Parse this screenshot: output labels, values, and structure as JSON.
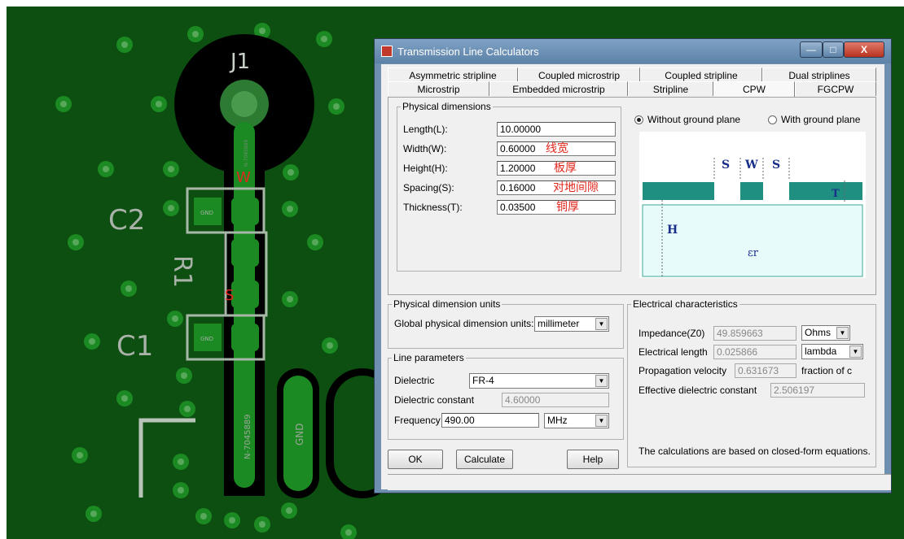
{
  "pcb": {
    "ref_j1": "J1",
    "ref_c2": "C2",
    "ref_c1": "C1",
    "ref_r1": "R1",
    "mark_w": "W",
    "mark_s": "S",
    "pad_gnd_1": "GND",
    "pad_gnd_2": "GND",
    "gnd_label": "GND",
    "net_label_bottom": "N-7045889",
    "net_label_top": "N-7045889",
    "colors": {
      "board": "#0c4f11",
      "copper": "#1c8a23",
      "text": "#9aa89a",
      "annotation": "#e0271c"
    }
  },
  "window": {
    "title": "Transmission Line Calculators",
    "controls": {
      "minimize": "—",
      "maximize": "□",
      "close": "X"
    }
  },
  "tabs": {
    "row1": [
      "Asymmetric stripline",
      "Coupled microstrip",
      "Coupled stripline",
      "Dual striplines"
    ],
    "row2": [
      "Microstrip",
      "Embedded microstrip",
      "Stripline",
      "CPW",
      "FGCPW"
    ],
    "active": "CPW"
  },
  "physical": {
    "legend": "Physical dimensions",
    "length": {
      "label": "Length(L):",
      "value": "10.00000"
    },
    "width": {
      "label": "Width(W):",
      "value": "0.60000",
      "note": "线宽"
    },
    "height": {
      "label": "Height(H):",
      "value": "1.20000",
      "note": "板厚"
    },
    "spacing": {
      "label": "Spacing(S):",
      "value": "0.16000",
      "note": "对地间隙"
    },
    "thickness": {
      "label": "Thickness(T):",
      "value": "0.03500",
      "note": "铜厚"
    }
  },
  "ground": {
    "without": "Without ground plane",
    "with": "With ground plane",
    "selected": "without"
  },
  "diagram": {
    "S1": "S",
    "W": "W",
    "S2": "S",
    "T": "T",
    "H": "H",
    "eps": "εr"
  },
  "units": {
    "legend": "Physical dimension units",
    "label": "Global physical dimension units:",
    "value": "millimeter"
  },
  "line": {
    "legend": "Line parameters",
    "dielectric_label": "Dielectric",
    "dielectric_value": "FR-4",
    "dk_label": "Dielectric constant",
    "dk_value": "4.60000",
    "freq_label": "Frequency",
    "freq_value": "490.00",
    "freq_unit": "MHz"
  },
  "electrical": {
    "legend": "Electrical characteristics",
    "z0_label": "Impedance(Z0)",
    "z0_value": "49.859663",
    "z0_unit": "Ohms",
    "len_label": "Electrical length",
    "len_value": "0.025866",
    "len_unit": "lambda",
    "vp_label": "Propagation velocity",
    "vp_value": "0.631673",
    "vp_unit": "fraction of c",
    "eeff_label": "Effective dielectric constant",
    "eeff_value": "2.506197",
    "note": "The calculations are based on closed-form equations."
  },
  "buttons": {
    "ok": "OK",
    "calculate": "Calculate",
    "help": "Help"
  }
}
